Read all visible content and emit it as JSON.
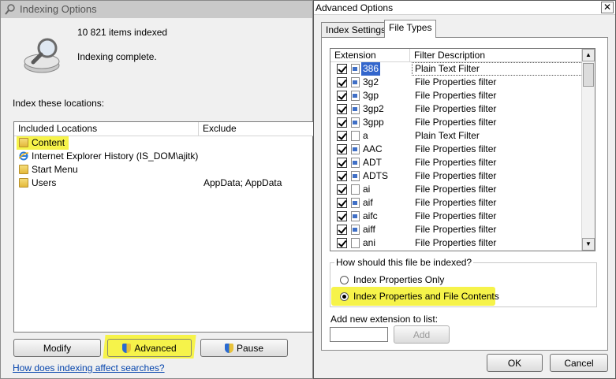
{
  "indexing": {
    "title": "Indexing Options",
    "items_indexed": "10 821 items indexed",
    "status": "Indexing complete.",
    "section_label": "Index these locations:",
    "col_included": "Included Locations",
    "col_exclude": "Exclude",
    "locations": [
      {
        "name": "Content",
        "exclude": "",
        "icon": "folder-icon",
        "highlighted": true
      },
      {
        "name": "Internet Explorer History (IS_DOM\\ajitk)",
        "exclude": "",
        "icon": "ie-icon",
        "highlighted": false
      },
      {
        "name": "Start Menu",
        "exclude": "",
        "icon": "folder-icon",
        "highlighted": false
      },
      {
        "name": "Users",
        "exclude": "AppData; AppData",
        "icon": "folder-icon",
        "highlighted": false
      }
    ],
    "btn_modify": "Modify",
    "btn_advanced": "Advanced",
    "btn_pause": "Pause",
    "help_link": "How does indexing affect searches?",
    "highlight_color": "#f6f34a"
  },
  "advanced": {
    "title": "Advanced Options",
    "close_glyph": "✕",
    "tabs": [
      "Index Settings",
      "File Types"
    ],
    "active_tab": "File Types",
    "col_extension": "Extension",
    "col_description": "Filter Description",
    "file_types": [
      {
        "ext": "386",
        "desc": "Plain Text Filter",
        "checked": true,
        "selected": true,
        "icon": "property-file-icon"
      },
      {
        "ext": "3g2",
        "desc": "File Properties filter",
        "checked": true,
        "selected": false,
        "icon": "property-file-icon"
      },
      {
        "ext": "3gp",
        "desc": "File Properties filter",
        "checked": true,
        "selected": false,
        "icon": "property-file-icon"
      },
      {
        "ext": "3gp2",
        "desc": "File Properties filter",
        "checked": true,
        "selected": false,
        "icon": "property-file-icon"
      },
      {
        "ext": "3gpp",
        "desc": "File Properties filter",
        "checked": true,
        "selected": false,
        "icon": "property-file-icon"
      },
      {
        "ext": "a",
        "desc": "Plain Text Filter",
        "checked": true,
        "selected": false,
        "icon": "blank-file-icon"
      },
      {
        "ext": "AAC",
        "desc": "File Properties filter",
        "checked": true,
        "selected": false,
        "icon": "property-file-icon"
      },
      {
        "ext": "ADT",
        "desc": "File Properties filter",
        "checked": true,
        "selected": false,
        "icon": "property-file-icon"
      },
      {
        "ext": "ADTS",
        "desc": "File Properties filter",
        "checked": true,
        "selected": false,
        "icon": "property-file-icon"
      },
      {
        "ext": "ai",
        "desc": "File Properties filter",
        "checked": true,
        "selected": false,
        "icon": "blank-file-icon"
      },
      {
        "ext": "aif",
        "desc": "File Properties filter",
        "checked": true,
        "selected": false,
        "icon": "property-file-icon"
      },
      {
        "ext": "aifc",
        "desc": "File Properties filter",
        "checked": true,
        "selected": false,
        "icon": "property-file-icon"
      },
      {
        "ext": "aiff",
        "desc": "File Properties filter",
        "checked": true,
        "selected": false,
        "icon": "property-file-icon"
      },
      {
        "ext": "ani",
        "desc": "File Properties filter",
        "checked": true,
        "selected": false,
        "icon": "blank-file-icon"
      }
    ],
    "group_label": "How should this file be indexed?",
    "radio_props_only": "Index Properties Only",
    "radio_props_contents": "Index Properties and File Contents",
    "selected_radio": "Index Properties and File Contents",
    "add_ext_label": "Add new extension to list:",
    "add_ext_value": "",
    "btn_add": "Add",
    "btn_ok": "OK",
    "btn_cancel": "Cancel"
  }
}
